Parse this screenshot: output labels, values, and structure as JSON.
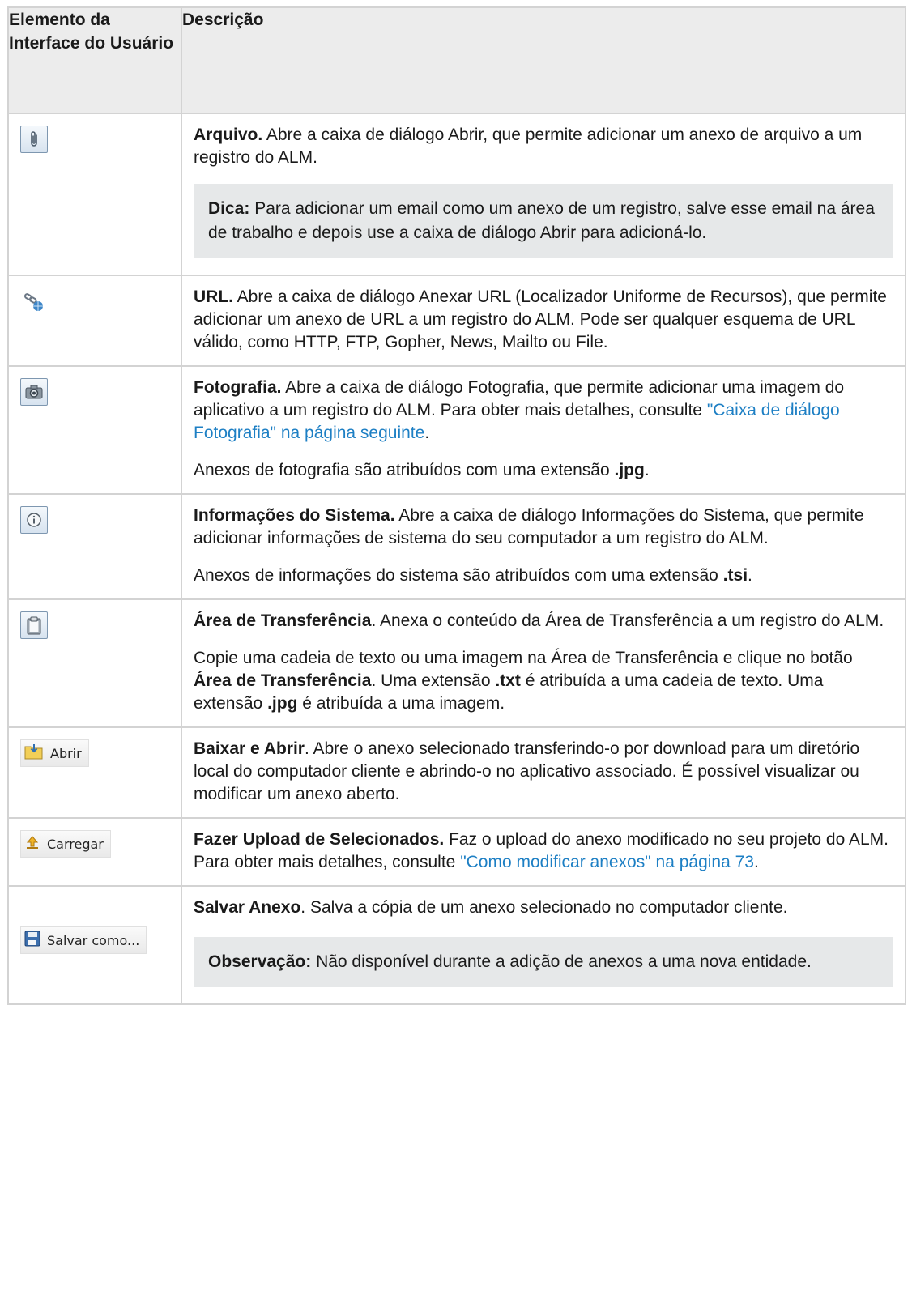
{
  "header": {
    "col1": "Elemento da Interface do Usuário",
    "col2": "Descrição"
  },
  "rows": {
    "arquivo": {
      "icon": "paperclip-icon",
      "title": "Arquivo.",
      "text": " Abre a caixa de diálogo Abrir, que permite adicionar um anexo de arquivo a um registro do ALM.",
      "note_label": "Dica:",
      "note_text": " Para adicionar um email como um anexo de um registro, salve esse email na área de trabalho e depois use a caixa de diálogo Abrir para adicioná-lo."
    },
    "url": {
      "icon": "link-globe-icon",
      "title": "URL.",
      "text": " Abre a caixa de diálogo Anexar URL (Localizador Uniforme de Recursos), que permite adicionar um anexo de URL a um registro do ALM. Pode ser qualquer esquema de URL válido, como HTTP, FTP, Gopher, News, Mailto ou File."
    },
    "foto": {
      "icon": "camera-icon",
      "title": "Fotografia.",
      "text": " Abre a caixa de diálogo Fotografia, que permite adicionar uma imagem do aplicativo a um registro do ALM. Para obter mais detalhes, consulte ",
      "link": "\"Caixa de diálogo Fotografia\" na página seguinte",
      "text_end": ".",
      "p2_a": "Anexos de fotografia são atribuídos com uma extensão ",
      "p2_b": ".jpg",
      "p2_c": "."
    },
    "info": {
      "icon": "info-icon",
      "title": "Informações do Sistema.",
      "text": " Abre a caixa de diálogo Informações do Sistema, que permite adicionar informações de sistema do seu computador a um registro do ALM.",
      "p2_a": "Anexos de informações do sistema são atribuídos com uma extensão ",
      "p2_b": ".tsi",
      "p2_c": "."
    },
    "clip": {
      "icon": "clipboard-icon",
      "title": "Área de Transferência",
      "text": ". Anexa o conteúdo da Área de Transferência a um registro do ALM.",
      "p2_a": "Copie uma cadeia de texto ou uma imagem na Área de Transferência e clique no botão ",
      "p2_b": "Área de Transferência",
      "p2_c": ". Uma extensão ",
      "p2_d": ".txt",
      "p2_e": " é atribuída a uma cadeia de texto. Uma extensão ",
      "p2_f": ".jpg",
      "p2_g": " é atribuída a uma imagem."
    },
    "abrir": {
      "icon": "folder-download-icon",
      "button": "Abrir",
      "title": "Baixar e Abrir",
      "text": ". Abre o anexo selecionado transferindo-o por download para um diretório local do computador cliente e abrindo-o no aplicativo associado. É possível visualizar ou modificar um anexo aberto."
    },
    "upload": {
      "icon": "upload-arrow-icon",
      "button": "Carregar",
      "title": "Fazer Upload de Selecionados.",
      "text": " Faz o upload do anexo modificado no seu projeto do ALM. Para obter mais detalhes, consulte ",
      "link": "\"Como modificar anexos\" na página 73",
      "text_end": "."
    },
    "salvar": {
      "icon": "floppy-disk-icon",
      "button": "Salvar como...",
      "title": "Salvar Anexo",
      "text": ". Salva a cópia de um anexo selecionado no computador cliente.",
      "note_label": "Observação:",
      "note_text": " Não disponível durante a adição de anexos a uma nova entidade."
    }
  },
  "colors": {
    "link": "#1d7fc4",
    "header_bg": "#ececec",
    "note_bg": "#e6e8e9",
    "border": "#d3d3d3"
  }
}
